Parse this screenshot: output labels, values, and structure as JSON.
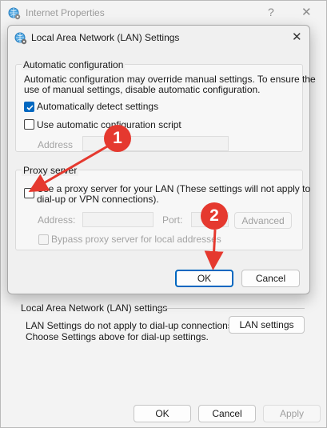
{
  "outer": {
    "title": "Internet Properties",
    "help_glyph": "?",
    "close_glyph": "✕",
    "lan_group_header": "Local Area Network (LAN) settings",
    "lan_note_line1": "LAN Settings do not apply to dial-up connections.",
    "lan_note_line2": "Choose Settings above for dial-up settings.",
    "lan_settings_button": "LAN settings",
    "ok_button": "OK",
    "cancel_button": "Cancel",
    "apply_button": "Apply"
  },
  "dialog": {
    "title": "Local Area Network (LAN) Settings",
    "close_glyph": "✕",
    "auto_config": {
      "label": "Automatic configuration",
      "desc_line1": "Automatic configuration may override manual settings.  To ensure the",
      "desc_line2": "use of manual settings, disable automatic configuration.",
      "detect_label": "Automatically detect settings",
      "detect_checked": true,
      "script_label": "Use automatic configuration script",
      "script_checked": false,
      "address_label": "Address",
      "address_value": ""
    },
    "proxy": {
      "label": "Proxy server",
      "use_proxy_line1": "Use a proxy server for your LAN (These settings will not apply to",
      "use_proxy_line2": "dial-up or VPN connections).",
      "use_proxy_checked": false,
      "address_label": "Address:",
      "address_value": "",
      "port_label": "Port:",
      "port_value": "",
      "advanced_button": "Advanced",
      "bypass_label": "Bypass proxy server for local addresses",
      "bypass_checked": false
    },
    "ok_button": "OK",
    "cancel_button": "Cancel"
  },
  "annotations": {
    "badge_1": "1",
    "badge_2": "2",
    "color": "#e5392f"
  },
  "colors": {
    "accent": "#0067c0",
    "annotation_red": "#e5392f"
  }
}
